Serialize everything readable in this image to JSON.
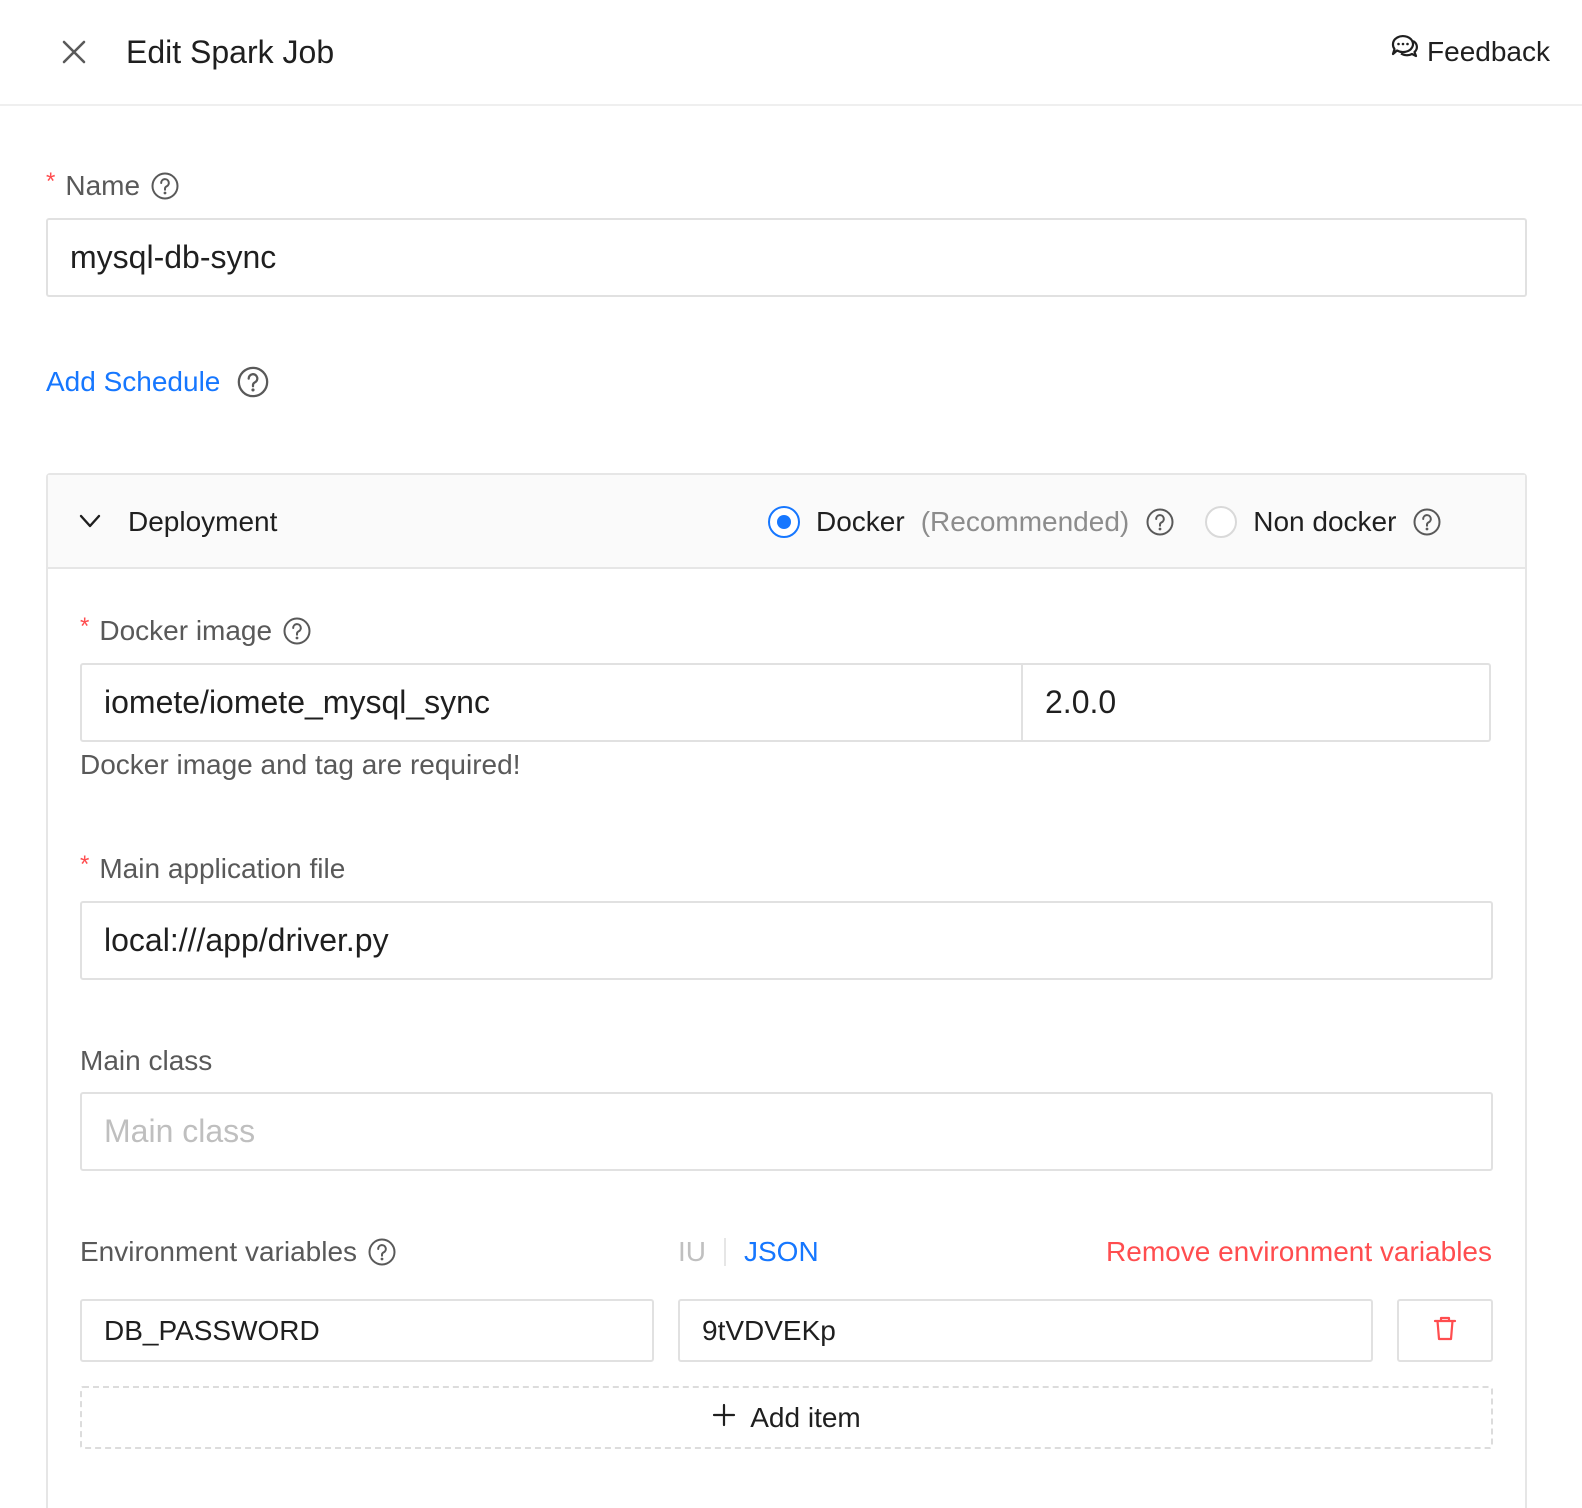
{
  "header": {
    "title": "Edit Spark Job",
    "feedback_label": "Feedback"
  },
  "name_field": {
    "label": "Name",
    "value": "mysql-db-sync"
  },
  "add_schedule_label": "Add Schedule",
  "deployment": {
    "title": "Deployment",
    "options": [
      {
        "label": "Docker",
        "sublabel": "(Recommended)",
        "selected": true
      },
      {
        "label": "Non docker",
        "selected": false
      }
    ],
    "docker_image": {
      "label": "Docker image",
      "image": "iomete/iomete_mysql_sync",
      "tag": "2.0.0",
      "hint": "Docker image and tag are required!"
    },
    "main_application_file": {
      "label": "Main application file",
      "value": "local:///app/driver.py"
    },
    "main_class": {
      "label": "Main class",
      "placeholder": "Main class"
    },
    "env_vars": {
      "label": "Environment variables",
      "mode_iu": "IU",
      "mode_json": "JSON",
      "active_mode": "JSON",
      "remove_label": "Remove environment variables",
      "items": [
        {
          "key": "DB_PASSWORD",
          "value": "9tVDVEKp"
        }
      ],
      "add_item_label": "Add item"
    }
  },
  "colors": {
    "accent": "#1677ff",
    "danger": "#ff4d4f",
    "border": "#e1e1e1"
  }
}
